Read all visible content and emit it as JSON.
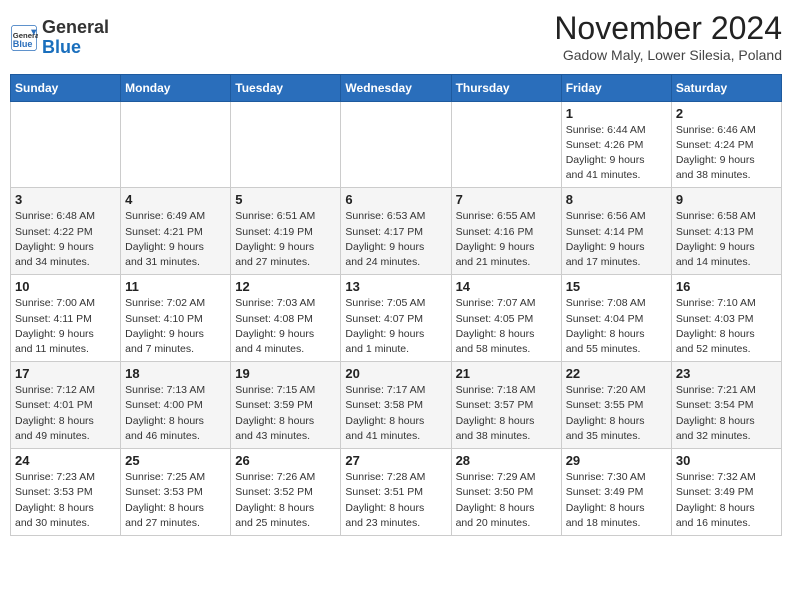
{
  "logo": {
    "general": "General",
    "blue": "Blue"
  },
  "title": "November 2024",
  "subtitle": "Gadow Maly, Lower Silesia, Poland",
  "weekdays": [
    "Sunday",
    "Monday",
    "Tuesday",
    "Wednesday",
    "Thursday",
    "Friday",
    "Saturday"
  ],
  "weeks": [
    [
      {
        "day": "",
        "info": ""
      },
      {
        "day": "",
        "info": ""
      },
      {
        "day": "",
        "info": ""
      },
      {
        "day": "",
        "info": ""
      },
      {
        "day": "",
        "info": ""
      },
      {
        "day": "1",
        "info": "Sunrise: 6:44 AM\nSunset: 4:26 PM\nDaylight: 9 hours\nand 41 minutes."
      },
      {
        "day": "2",
        "info": "Sunrise: 6:46 AM\nSunset: 4:24 PM\nDaylight: 9 hours\nand 38 minutes."
      }
    ],
    [
      {
        "day": "3",
        "info": "Sunrise: 6:48 AM\nSunset: 4:22 PM\nDaylight: 9 hours\nand 34 minutes."
      },
      {
        "day": "4",
        "info": "Sunrise: 6:49 AM\nSunset: 4:21 PM\nDaylight: 9 hours\nand 31 minutes."
      },
      {
        "day": "5",
        "info": "Sunrise: 6:51 AM\nSunset: 4:19 PM\nDaylight: 9 hours\nand 27 minutes."
      },
      {
        "day": "6",
        "info": "Sunrise: 6:53 AM\nSunset: 4:17 PM\nDaylight: 9 hours\nand 24 minutes."
      },
      {
        "day": "7",
        "info": "Sunrise: 6:55 AM\nSunset: 4:16 PM\nDaylight: 9 hours\nand 21 minutes."
      },
      {
        "day": "8",
        "info": "Sunrise: 6:56 AM\nSunset: 4:14 PM\nDaylight: 9 hours\nand 17 minutes."
      },
      {
        "day": "9",
        "info": "Sunrise: 6:58 AM\nSunset: 4:13 PM\nDaylight: 9 hours\nand 14 minutes."
      }
    ],
    [
      {
        "day": "10",
        "info": "Sunrise: 7:00 AM\nSunset: 4:11 PM\nDaylight: 9 hours\nand 11 minutes."
      },
      {
        "day": "11",
        "info": "Sunrise: 7:02 AM\nSunset: 4:10 PM\nDaylight: 9 hours\nand 7 minutes."
      },
      {
        "day": "12",
        "info": "Sunrise: 7:03 AM\nSunset: 4:08 PM\nDaylight: 9 hours\nand 4 minutes."
      },
      {
        "day": "13",
        "info": "Sunrise: 7:05 AM\nSunset: 4:07 PM\nDaylight: 9 hours\nand 1 minute."
      },
      {
        "day": "14",
        "info": "Sunrise: 7:07 AM\nSunset: 4:05 PM\nDaylight: 8 hours\nand 58 minutes."
      },
      {
        "day": "15",
        "info": "Sunrise: 7:08 AM\nSunset: 4:04 PM\nDaylight: 8 hours\nand 55 minutes."
      },
      {
        "day": "16",
        "info": "Sunrise: 7:10 AM\nSunset: 4:03 PM\nDaylight: 8 hours\nand 52 minutes."
      }
    ],
    [
      {
        "day": "17",
        "info": "Sunrise: 7:12 AM\nSunset: 4:01 PM\nDaylight: 8 hours\nand 49 minutes."
      },
      {
        "day": "18",
        "info": "Sunrise: 7:13 AM\nSunset: 4:00 PM\nDaylight: 8 hours\nand 46 minutes."
      },
      {
        "day": "19",
        "info": "Sunrise: 7:15 AM\nSunset: 3:59 PM\nDaylight: 8 hours\nand 43 minutes."
      },
      {
        "day": "20",
        "info": "Sunrise: 7:17 AM\nSunset: 3:58 PM\nDaylight: 8 hours\nand 41 minutes."
      },
      {
        "day": "21",
        "info": "Sunrise: 7:18 AM\nSunset: 3:57 PM\nDaylight: 8 hours\nand 38 minutes."
      },
      {
        "day": "22",
        "info": "Sunrise: 7:20 AM\nSunset: 3:55 PM\nDaylight: 8 hours\nand 35 minutes."
      },
      {
        "day": "23",
        "info": "Sunrise: 7:21 AM\nSunset: 3:54 PM\nDaylight: 8 hours\nand 32 minutes."
      }
    ],
    [
      {
        "day": "24",
        "info": "Sunrise: 7:23 AM\nSunset: 3:53 PM\nDaylight: 8 hours\nand 30 minutes."
      },
      {
        "day": "25",
        "info": "Sunrise: 7:25 AM\nSunset: 3:53 PM\nDaylight: 8 hours\nand 27 minutes."
      },
      {
        "day": "26",
        "info": "Sunrise: 7:26 AM\nSunset: 3:52 PM\nDaylight: 8 hours\nand 25 minutes."
      },
      {
        "day": "27",
        "info": "Sunrise: 7:28 AM\nSunset: 3:51 PM\nDaylight: 8 hours\nand 23 minutes."
      },
      {
        "day": "28",
        "info": "Sunrise: 7:29 AM\nSunset: 3:50 PM\nDaylight: 8 hours\nand 20 minutes."
      },
      {
        "day": "29",
        "info": "Sunrise: 7:30 AM\nSunset: 3:49 PM\nDaylight: 8 hours\nand 18 minutes."
      },
      {
        "day": "30",
        "info": "Sunrise: 7:32 AM\nSunset: 3:49 PM\nDaylight: 8 hours\nand 16 minutes."
      }
    ]
  ]
}
